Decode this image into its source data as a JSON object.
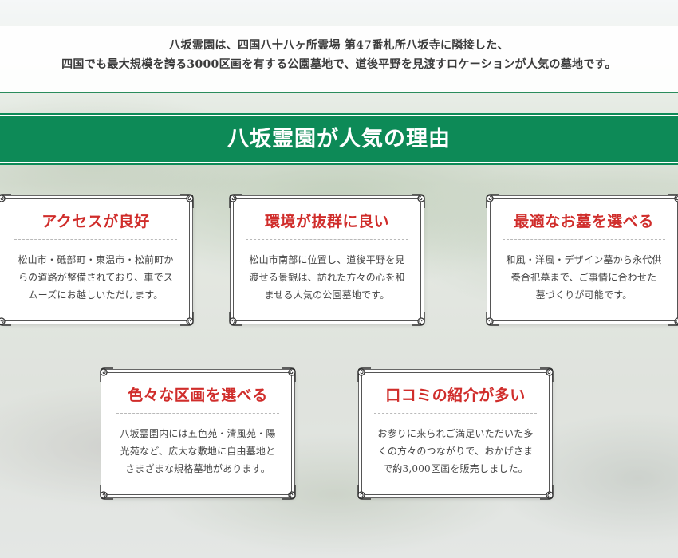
{
  "intro": {
    "line1": "八坂霊園は、四国八十八ヶ所霊場 第47番札所八坂寺に隣接した、",
    "line2": "四国でも最大規模を誇る3000区画を有する公園墓地で、道後平野を見渡すロケーションが人気の墓地です。"
  },
  "section": {
    "heading": "八坂霊園が人気の理由"
  },
  "cards": [
    {
      "title": "アクセスが良好",
      "lines": [
        "松山市・砥部町・東温市・松前町か",
        "らの道路が整備されており、車でス",
        "ムーズにお越しいただけます。"
      ]
    },
    {
      "title": "環境が抜群に良い",
      "lines": [
        "松山市南部に位置し、道後平野を見",
        "渡せる景観は、訪れた方々の心を和",
        "ませる人気の公園墓地です。"
      ]
    },
    {
      "title": "最適なお墓を選べる",
      "lines": [
        "和風・洋風・デザイン墓から永代供",
        "養合祀墓まで、ご事情に合わせた",
        "墓づくりが可能です。"
      ]
    },
    {
      "title": "色々な区画を選べる",
      "lines": [
        "八坂霊園内には五色苑・清風苑・陽",
        "光苑など、広大な敷地に自由墓地と",
        "さまざまな規格墓地があります。"
      ]
    },
    {
      "title": "口コミの紹介が多い",
      "lines": [
        "お参りに来られご満足いただいた多",
        "くの方々のつながりで、おかげさま",
        "で約3,000区画を販売しました。"
      ]
    }
  ],
  "colors": {
    "heading_bg": "#0d8a57",
    "card_title": "#d02d2b",
    "intro_text": "#3b3b3b"
  },
  "icons": {
    "card_corner": "scroll-ornament-icon"
  }
}
